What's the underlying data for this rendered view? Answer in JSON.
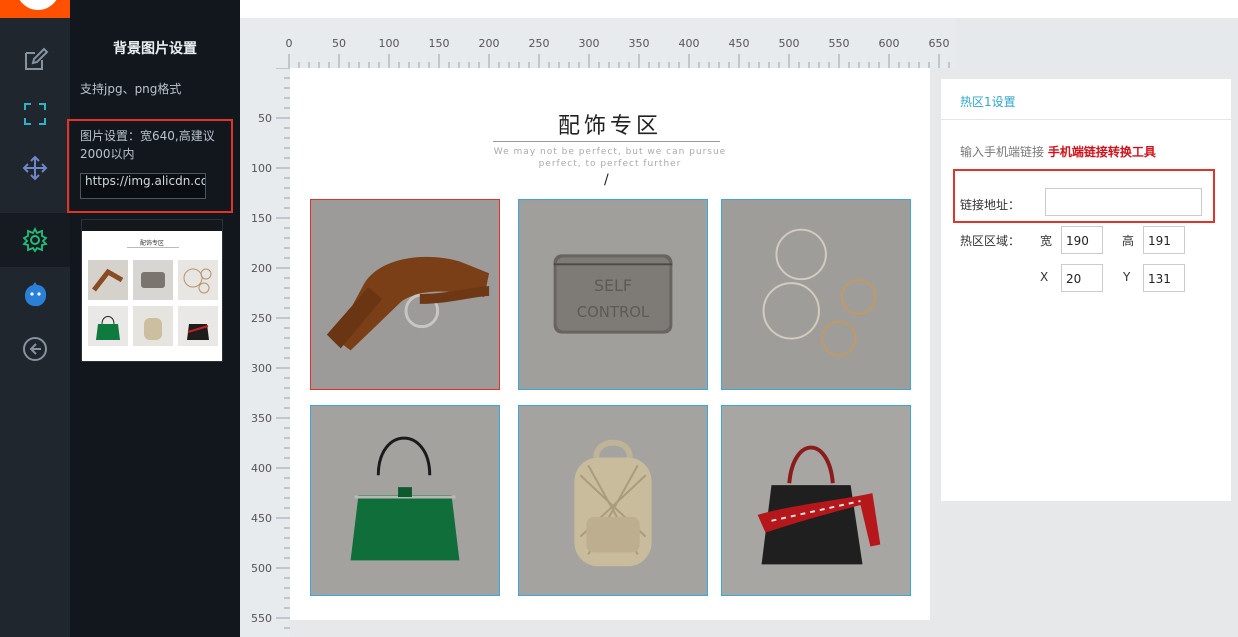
{
  "colors": {
    "accent": "#ff5000",
    "selection": "#e0342a",
    "hotspot": "#3aa8d8",
    "link": "#d0121b"
  },
  "rail": {
    "icons": [
      "edit-icon",
      "crop-frame-icon",
      "move-arrows-icon",
      "gear-icon",
      "mascot-icon",
      "back-arrow-icon"
    ]
  },
  "panel": {
    "title": "背景图片设置",
    "format_note": "支持jpg、png格式",
    "size_note": "图片设置：宽640,高建议2000以内",
    "url_value": "https://img.alicdn.com/",
    "thumbnail_title": "配饰专区"
  },
  "ruler": {
    "h_ticks": [
      "0",
      "50",
      "100",
      "150",
      "200",
      "250",
      "300",
      "350",
      "400",
      "450",
      "500",
      "550",
      "600",
      "650"
    ],
    "v_ticks": [
      "50",
      "100",
      "150",
      "200",
      "250",
      "300",
      "350",
      "400",
      "450",
      "500",
      "550"
    ]
  },
  "canvas": {
    "title": "配饰专区",
    "subtitle_line1": "We may not be perfect, but we can pursue",
    "subtitle_line2": "perfect, to perfect further",
    "divider": "/",
    "products": [
      "brown-belt",
      "silver-wallet",
      "hoop-earrings",
      "green-handbag",
      "crochet-backpack",
      "black-tote-bag"
    ]
  },
  "hotspot_settings": {
    "tab_title": "热区1设置",
    "hint_text": "输入手机端链接",
    "tool_link": "手机端链接转换工具",
    "link_label": "链接地址：",
    "link_value": "",
    "area_label": "热区区域：",
    "width_label": "宽",
    "width_value": "190",
    "height_label": "高",
    "height_value": "191",
    "x_label": "X",
    "x_value": "20",
    "y_label": "Y",
    "y_value": "131"
  }
}
